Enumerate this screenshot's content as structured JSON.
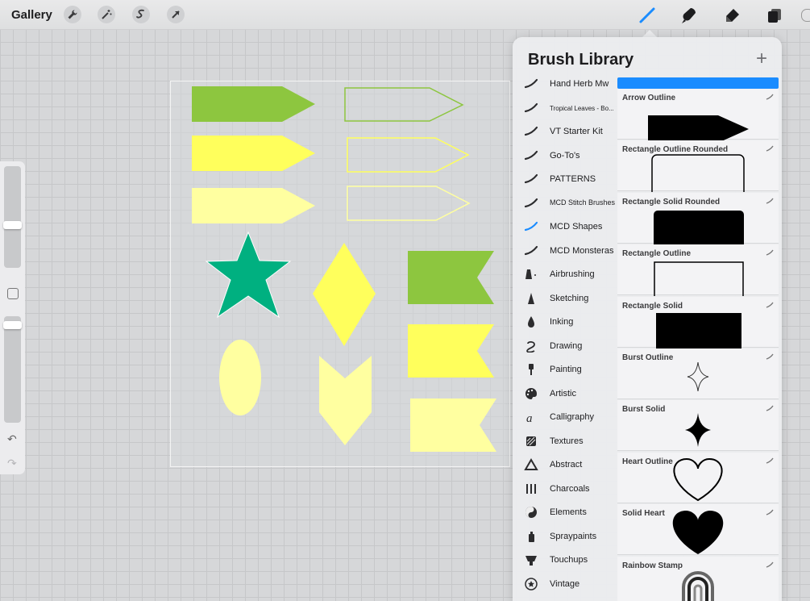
{
  "toolbar": {
    "gallery_label": "Gallery",
    "left_tools": [
      "wrench-icon",
      "magic-wand-icon",
      "selection-icon",
      "transform-arrow-icon"
    ],
    "right_tools": [
      "brush-icon",
      "smudge-icon",
      "eraser-icon",
      "layers-icon"
    ],
    "active_tool": "brush-icon",
    "accent_color": "#1a8cff"
  },
  "artboard": {
    "shape_colors": [
      "#8dc63f",
      "#ffff66",
      "#ffffa0",
      "#00b080"
    ]
  },
  "sidebar": {
    "brush_size_level": 0.28,
    "opacity_level": 0.1,
    "undo_icon": "undo-icon",
    "redo_icon": "redo-icon"
  },
  "brush_library": {
    "title": "Brush Library",
    "add_icon": "plus-icon",
    "selected_set": "MCD Shapes",
    "sets": [
      {
        "label": "Hand Herb Mw",
        "icon": "brush-stroke-icon"
      },
      {
        "label": "Tropical Leaves - Bo...",
        "icon": "brush-stroke-icon"
      },
      {
        "label": "VT Starter Kit",
        "icon": "brush-stroke-icon"
      },
      {
        "label": "Go-To's",
        "icon": "brush-stroke-icon"
      },
      {
        "label": "PATTERNS",
        "icon": "brush-stroke-icon"
      },
      {
        "label": "MCD Stitch Brushes",
        "icon": "brush-stroke-icon"
      },
      {
        "label": "MCD Shapes",
        "icon": "brush-stroke-icon"
      },
      {
        "label": "MCD Monsteras",
        "icon": "brush-stroke-icon"
      },
      {
        "label": "Airbrushing",
        "icon": "airbrush-icon"
      },
      {
        "label": "Sketching",
        "icon": "pencil-tip-icon"
      },
      {
        "label": "Inking",
        "icon": "ink-drop-icon"
      },
      {
        "label": "Drawing",
        "icon": "swirl-icon"
      },
      {
        "label": "Painting",
        "icon": "paintbrush-icon"
      },
      {
        "label": "Artistic",
        "icon": "palette-icon"
      },
      {
        "label": "Calligraphy",
        "icon": "calligraphy-a-icon"
      },
      {
        "label": "Textures",
        "icon": "texture-icon"
      },
      {
        "label": "Abstract",
        "icon": "triangle-icon"
      },
      {
        "label": "Charcoals",
        "icon": "charcoal-icon"
      },
      {
        "label": "Elements",
        "icon": "yin-yang-icon"
      },
      {
        "label": "Spraypaints",
        "icon": "spray-can-icon"
      },
      {
        "label": "Touchups",
        "icon": "touchup-icon"
      },
      {
        "label": "Vintage",
        "icon": "star-badge-icon"
      }
    ],
    "brushes": [
      {
        "name": "Arrow Outline"
      },
      {
        "name": "Rectangle Outline Rounded"
      },
      {
        "name": "Rectangle Solid Rounded"
      },
      {
        "name": "Rectangle Outline"
      },
      {
        "name": "Rectangle Solid"
      },
      {
        "name": "Burst Outline"
      },
      {
        "name": "Burst Solid"
      },
      {
        "name": "Heart Outline"
      },
      {
        "name": "Solid Heart"
      },
      {
        "name": "Rainbow Stamp"
      }
    ]
  }
}
